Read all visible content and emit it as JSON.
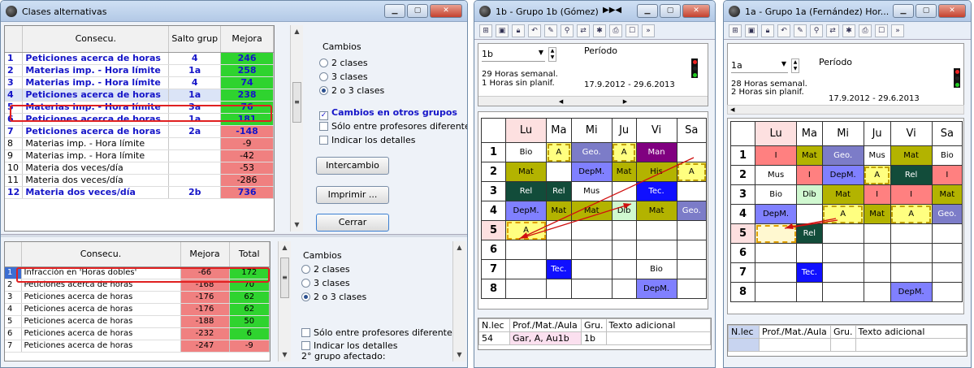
{
  "win1": {
    "title": "Clases alternativas",
    "top": {
      "headers": [
        "Consecu.",
        "Salto grup",
        "Mejora"
      ],
      "rows": [
        {
          "n": "1",
          "c": "Peticiones acerca de horas",
          "s": "4",
          "m": "246",
          "bold": true,
          "mc": "#2fd32f"
        },
        {
          "n": "2",
          "c": "Materias imp. - Hora límite",
          "s": "1a",
          "m": "258",
          "bold": true,
          "mc": "#2fd32f"
        },
        {
          "n": "3",
          "c": "Materias imp. - Hora límite",
          "s": "4",
          "m": "74",
          "bold": true,
          "mc": "#2fd32f"
        },
        {
          "n": "4",
          "c": "Peticiones acerca de horas",
          "s": "1a",
          "m": "238",
          "bold": true,
          "mc": "#2fd32f"
        },
        {
          "n": "5",
          "c": "Materias imp. - Hora límite",
          "s": "3a",
          "m": "76",
          "bold": true,
          "mc": "#2fd32f"
        },
        {
          "n": "6",
          "c": "Peticiones acerca de horas",
          "s": "1a",
          "m": "181",
          "bold": true,
          "mc": "#2fd32f"
        },
        {
          "n": "7",
          "c": "Peticiones acerca de horas",
          "s": "2a",
          "m": "-148",
          "bold": true,
          "mc": "#f08080"
        },
        {
          "n": "8",
          "c": "Materias imp. - Hora límite",
          "s": "",
          "m": "-9",
          "bold": false,
          "mc": "#f08080"
        },
        {
          "n": "9",
          "c": "Materias imp. - Hora límite",
          "s": "",
          "m": "-42",
          "bold": false,
          "mc": "#f08080"
        },
        {
          "n": "10",
          "c": "Materia dos veces/día",
          "s": "",
          "m": "-53",
          "bold": false,
          "mc": "#f08080"
        },
        {
          "n": "11",
          "c": "Materia dos veces/día",
          "s": "",
          "m": "-286",
          "bold": false,
          "mc": "#f08080"
        },
        {
          "n": "12",
          "c": "Materia dos veces/día",
          "s": "2b",
          "m": "736",
          "bold": true,
          "mc": "#f08080"
        }
      ]
    },
    "cambios_label": "Cambios",
    "radio1": "2 clases",
    "radio2": "3 clases",
    "radio3": "2 o 3 clases",
    "chk_otros": "Cambios en otros grupos",
    "chk_prof": "Sólo entre profesores diferentes",
    "chk_det": "Indicar los detalles",
    "btn_inter": "Intercambio",
    "btn_print": "Imprimir ...",
    "btn_close": "Cerrar",
    "bottom": {
      "headers": [
        "Consecu.",
        "Mejora",
        "Total"
      ],
      "rows": [
        {
          "n": "1",
          "c": "Infracción en 'Horas dobles'",
          "m": "-66",
          "t": "172",
          "tc": "#2fd32f"
        },
        {
          "n": "2",
          "c": "Peticiones acerca de horas",
          "m": "-168",
          "t": "70",
          "tc": "#2fd32f"
        },
        {
          "n": "3",
          "c": "Peticiones acerca de horas",
          "m": "-176",
          "t": "62",
          "tc": "#2fd32f"
        },
        {
          "n": "4",
          "c": "Peticiones acerca de horas",
          "m": "-176",
          "t": "62",
          "tc": "#2fd32f"
        },
        {
          "n": "5",
          "c": "Peticiones acerca de horas",
          "m": "-188",
          "t": "50",
          "tc": "#2fd32f"
        },
        {
          "n": "6",
          "c": "Peticiones acerca de horas",
          "m": "-232",
          "t": "6",
          "tc": "#2fd32f"
        },
        {
          "n": "7",
          "c": "Peticiones acerca de horas",
          "m": "-247",
          "t": "-9",
          "tc": "#f08080"
        }
      ]
    },
    "chk_prof2": "Sólo entre profesores diferentes",
    "chk_det2": "Indicar los detalles",
    "second_group": "2° grupo afectado:"
  },
  "win2": {
    "title": "1b - Grupo 1b (Gómez)",
    "class_sel": "1b",
    "periodo_label": "Período",
    "info1": "29 Horas semanal.",
    "info2": "1 Horas sin planif.",
    "dates": "17.9.2012 - 29.6.2013",
    "days": [
      "Lu",
      "Ma",
      "Mi",
      "Ju",
      "Vi",
      "Sa"
    ],
    "periods": [
      "1",
      "2",
      "3",
      "4",
      "5",
      "6",
      "7",
      "8"
    ],
    "cells": {
      "r1": [
        "Bio",
        "A",
        "Geo.",
        "A",
        "Man",
        ""
      ],
      "r2": [
        "Mat",
        "",
        "DepM.",
        "Mat",
        "His",
        "A"
      ],
      "r3": [
        "Rel",
        "Rel",
        "Mus",
        "",
        "Tec.",
        ""
      ],
      "r4": [
        "DepM.",
        "Mat",
        "Mat",
        "Dib",
        "Mat",
        "Geo."
      ],
      "r5": [
        "A",
        "",
        "",
        "",
        "",
        ""
      ],
      "r7": [
        "",
        "Tec.",
        "",
        "",
        "Bio",
        ""
      ],
      "r8": [
        "",
        "",
        "",
        "",
        "DepM.",
        ""
      ]
    },
    "lec_headers": [
      "N.lec",
      "Prof./Mat./Aula",
      "Gru.",
      "Texto adicional"
    ],
    "lec_row": [
      "54",
      "Gar, A, Au1b",
      "1b",
      ""
    ]
  },
  "win3": {
    "title": "1a - Grupo 1a (Fernández) Hor...",
    "class_sel": "1a",
    "periodo_label": "Período",
    "info1": "28 Horas semanal.",
    "info2": "2 Horas sin planif.",
    "dates": "17.9.2012 - 29.6.2013",
    "days": [
      "Lu",
      "Ma",
      "Mi",
      "Ju",
      "Vi",
      "Sa"
    ],
    "periods": [
      "1",
      "2",
      "3",
      "4",
      "5",
      "6",
      "7",
      "8"
    ],
    "cells": {
      "r1": [
        "I",
        "Mat",
        "Geo.",
        "Mus",
        "Mat",
        "Bio"
      ],
      "r2": [
        "Mus",
        "I",
        "DepM.",
        "A",
        "Rel",
        "I"
      ],
      "r3": [
        "Bio",
        "Dib",
        "Mat",
        "I",
        "I",
        "Mat"
      ],
      "r4": [
        "DepM.",
        "",
        "A",
        "Mat",
        "A",
        "Geo."
      ],
      "r5": [
        "",
        "Rel",
        "",
        "",
        "",
        ""
      ],
      "r7": [
        "",
        "Tec.",
        "",
        "",
        "",
        ""
      ],
      "r8": [
        "",
        "",
        "",
        "",
        "DepM.",
        ""
      ]
    },
    "lec_headers": [
      "N.lec",
      "Prof./Mat./Aula",
      "Gru.",
      "Texto adicional"
    ]
  }
}
